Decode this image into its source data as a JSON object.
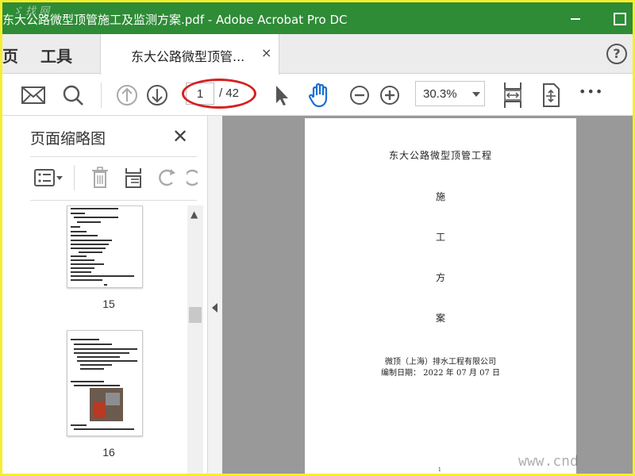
{
  "window": {
    "title": "东大公路微型顶管施工及监测方案.pdf - Adobe Acrobat Pro DC",
    "watermark_text": "ゞ 找 网"
  },
  "tabs": {
    "nav_page": "页",
    "nav_tools": "工具",
    "doc_tab_label": "东大公路微型顶管...",
    "close_symbol": "×",
    "help_symbol": "?"
  },
  "toolbar": {
    "current_page": "1",
    "total_pages": "/ 42",
    "zoom": "30.3%",
    "more": "•••"
  },
  "panel": {
    "title": "页面缩略图",
    "close_symbol": "✕",
    "thumbnails": [
      {
        "label": "15"
      },
      {
        "label": "16"
      }
    ]
  },
  "document": {
    "title": "东大公路微型顶管工程",
    "vertical_chars": [
      "施",
      "工",
      "方",
      "案"
    ],
    "company": "微顶（上海）排水工程有限公司",
    "date": "编制日期：  2022 年 07 月 07 日",
    "page_number": "1"
  },
  "bottom_watermark": "www.cnd",
  "colors": {
    "title_bar": "#2e8b36",
    "frame": "#f4ef2e",
    "annotation_circle": "#d62020",
    "hand_tool_active": "#1a6fd1"
  }
}
